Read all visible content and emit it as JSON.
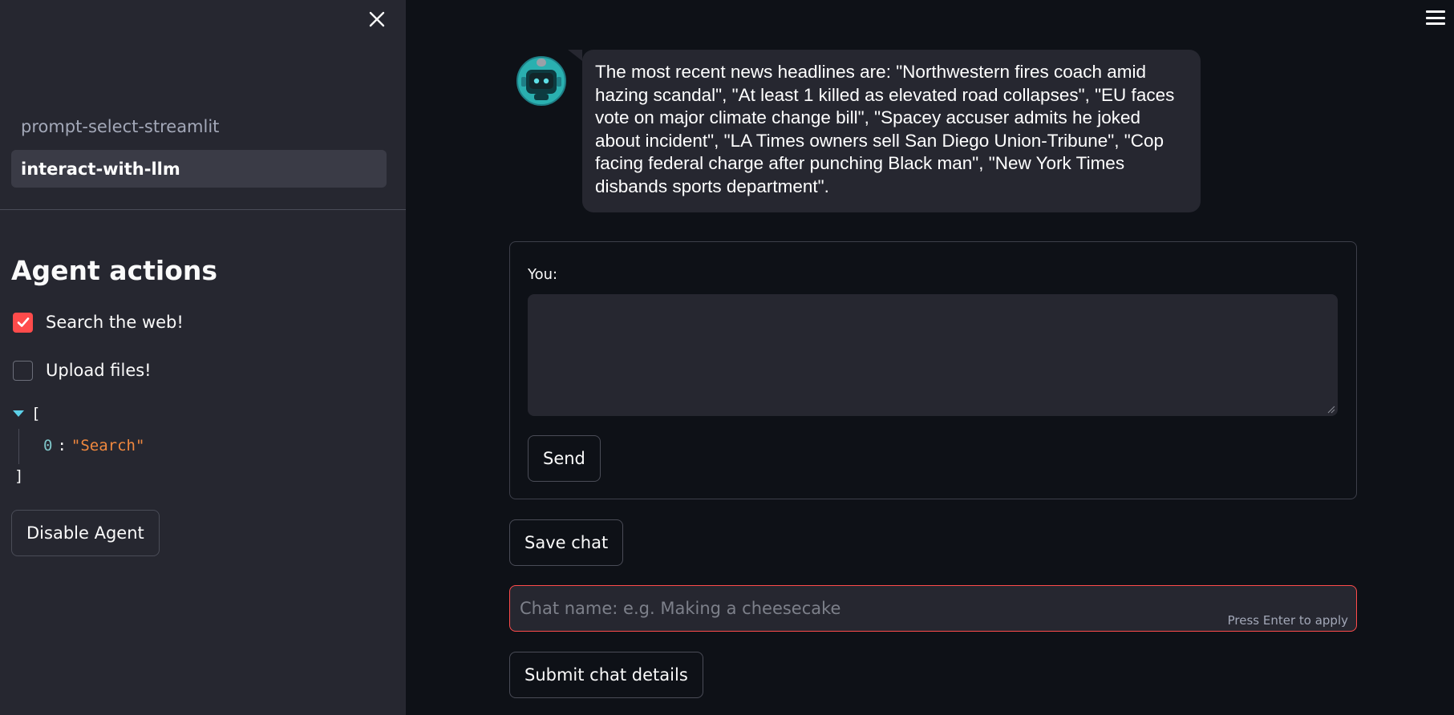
{
  "sidebar": {
    "nav": [
      {
        "label": "prompt-select-streamlit",
        "active": false
      },
      {
        "label": "interact-with-llm",
        "active": true
      }
    ],
    "heading": "Agent actions",
    "checkboxes": [
      {
        "label": "Search the web!",
        "checked": true
      },
      {
        "label": "Upload files!",
        "checked": false
      }
    ],
    "json_view": {
      "open": "[",
      "close": "]",
      "entries": [
        {
          "key": "0",
          "value": "\"Search\""
        }
      ]
    },
    "disable_button": "Disable Agent"
  },
  "chat": {
    "assistant_message": "The most recent news headlines are: \"Northwestern fires coach amid hazing scandal\", \"At least 1 killed as elevated road collapses\", \"EU faces vote on major climate change bill\", \"Spacey accuser admits he joked about incident\", \"LA Times owners sell San Diego Union-Tribune\", \"Cop facing federal charge after punching Black man\", \"New York Times disbands sports department\"."
  },
  "form": {
    "label": "You:",
    "textarea_value": "",
    "send_button": "Send"
  },
  "actions": {
    "save_button": "Save chat",
    "chat_name_placeholder": "Chat name: e.g. Making a cheesecake",
    "chat_name_hint": "Press Enter to apply",
    "submit_button": "Submit chat details"
  },
  "colors": {
    "accent": "#ff4b4b",
    "sidebar_bg": "#262730",
    "main_bg": "#0e1117"
  },
  "icons": [
    "close-icon",
    "hamburger-menu-icon",
    "checkmark-icon",
    "robot-avatar-icon",
    "triangle-down-icon",
    "resize-grip-icon"
  ]
}
